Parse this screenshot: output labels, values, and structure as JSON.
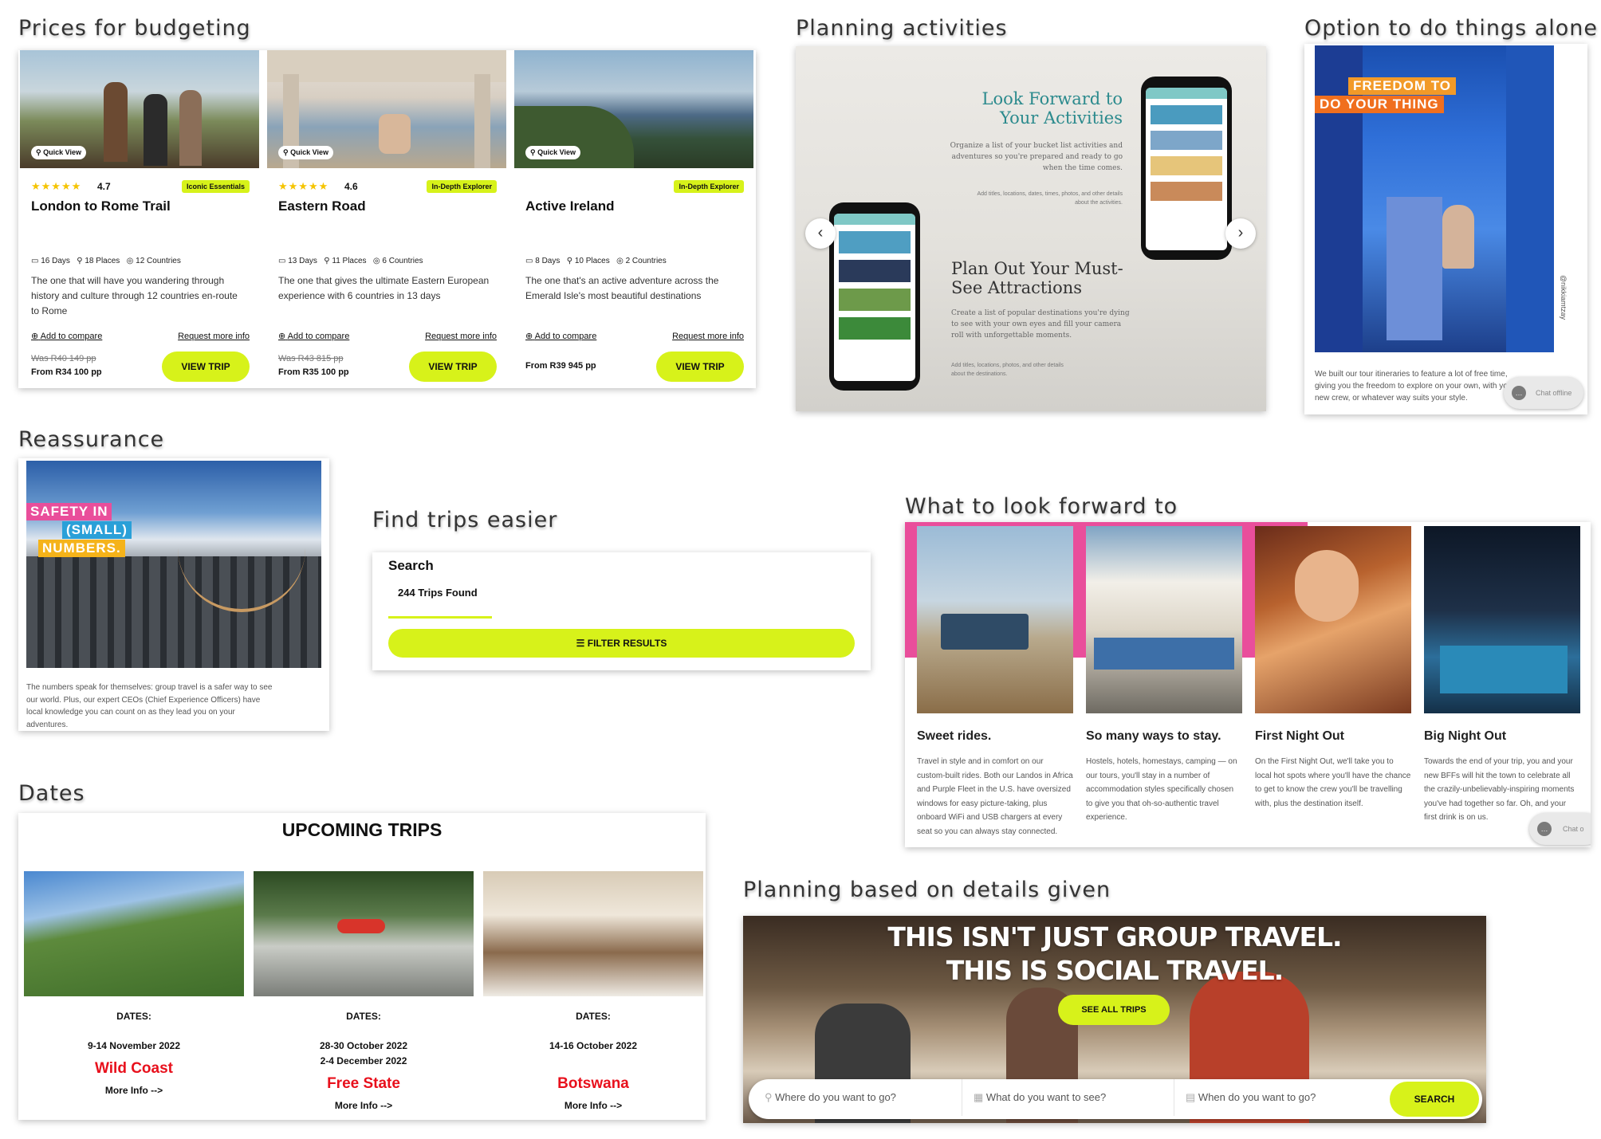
{
  "sections": {
    "budget": "Prices for budgeting",
    "activities": "Planning activities",
    "alone": "Option to do things alone",
    "reassurance": "Reassurance",
    "find": "Find trips easier",
    "forward": "What to look forward to",
    "dates": "Dates",
    "planning": "Planning based on details given"
  },
  "trip_cards": [
    {
      "quick_view": "Quick View",
      "rating": "4.7",
      "tag": "Iconic Essentials",
      "title": "London to Rome Trail",
      "days": "16 Days",
      "places": "18 Places",
      "countries": "12 Countries",
      "description": "The one that will have you wandering through history and culture through 12 countries en-route to Rome",
      "compare": "Add to compare",
      "request": "Request more info",
      "was": "Was R40 149 pp",
      "from": "From R34 100 pp",
      "button": "VIEW TRIP"
    },
    {
      "quick_view": "Quick View",
      "rating": "4.6",
      "tag": "In-Depth Explorer",
      "title": "Eastern Road",
      "days": "13 Days",
      "places": "11 Places",
      "countries": "6 Countries",
      "description": "The one that gives the ultimate Eastern European experience with 6 countries in 13 days",
      "compare": "Add to compare",
      "request": "Request more info",
      "was": "Was R43 815 pp",
      "from": "From R35 100 pp",
      "button": "VIEW TRIP"
    },
    {
      "quick_view": "Quick View",
      "rating": "",
      "tag": "In-Depth Explorer",
      "title": "Active Ireland",
      "days": "8 Days",
      "places": "10 Places",
      "countries": "2 Countries",
      "description": "The one that's an active adventure across the Emerald Isle's most beautiful destinations",
      "compare": "Add to compare",
      "request": "Request more info",
      "was": "",
      "from": "From R39 945 pp",
      "button": "VIEW TRIP"
    }
  ],
  "activities": {
    "heading1": "Look Forward to Your Activities",
    "body1": "Organize a list of your bucket list activities and adventures so you're prepared and ready to go when the time comes.",
    "small1": "Add titles, locations, dates, times, photos, and other details about the activities.",
    "heading2": "Plan Out Your Must-See Attractions",
    "body2": "Create a list of popular destinations you're dying to see with your own eyes and fill your camera roll with unforgettable moments.",
    "small2": "Add titles, locations, photos, and other details about the destinations."
  },
  "alone": {
    "overlay1": "FREEDOM TO",
    "overlay2": "DO YOUR THING",
    "credit": "@nikkiamtzay",
    "text": "We built our tour itineraries to feature a lot of free time, giving you the freedom to explore on your own, with your new crew, or whatever way suits your style.",
    "chat": "Chat offline"
  },
  "reassurance": {
    "line1": "SAFETY IN",
    "line2": "(SMALL)",
    "line3": "NUMBERS.",
    "text": "The numbers speak for themselves: group travel is a safer way to see our world. Plus, our expert CEOs (Chief Experience Officers) have local knowledge you can count on as they lead you on your adventures."
  },
  "search": {
    "title": "Search",
    "count": "244 Trips Found",
    "filter": "FILTER RESULTS"
  },
  "forward": [
    {
      "title": "Sweet rides.",
      "text": "Travel in style and in comfort on our custom-built rides. Both our Landos in Africa and Purple Fleet in the U.S. have oversized windows for easy picture-taking, plus onboard WiFi and USB chargers at every seat so you can always stay connected."
    },
    {
      "title": "So many ways to stay.",
      "text": "Hostels, hotels, homestays, camping — on our tours, you'll stay in a number of accommodation styles specifically chosen to give you that oh-so-authentic travel experience."
    },
    {
      "title": "First Night Out",
      "text": "On the First Night Out, we'll take you to local hot spots where you'll have the chance to get to know the crew you'll be travelling with, plus the destination itself."
    },
    {
      "title": "Big Night Out",
      "text": "Towards the end of your trip, you and your new BFFs will hit the town to celebrate all the crazily-unbelievably-inspiring moments you've had together so far. Oh, and your first drink is on us."
    }
  ],
  "forward_chat": "Chat o",
  "upcoming": {
    "title": "UPCOMING TRIPS",
    "trips": [
      {
        "label": "DATES:",
        "dates": [
          "9-14 November 2022"
        ],
        "place": "Wild Coast",
        "more": "More Info -->"
      },
      {
        "label": "DATES:",
        "dates": [
          "28-30 October 2022",
          "2-4 December 2022"
        ],
        "place": "Free State",
        "more": "More Info -->"
      },
      {
        "label": "DATES:",
        "dates": [
          "14-16 October 2022"
        ],
        "place": "Botswana",
        "more": "More Info -->"
      }
    ]
  },
  "hero": {
    "line1": "THIS ISN'T JUST GROUP TRAVEL.",
    "line2": "THIS IS SOCIAL TRAVEL.",
    "cta": "SEE ALL TRIPS",
    "where": "Where do you want to go?",
    "what": "What do you want to see?",
    "when": "When do you want to go?",
    "search": "SEARCH"
  },
  "colors": {
    "lime": "#d7f21a",
    "pink": "#e94e9b",
    "red": "#e8101c",
    "teal": "#2b8a8d"
  }
}
